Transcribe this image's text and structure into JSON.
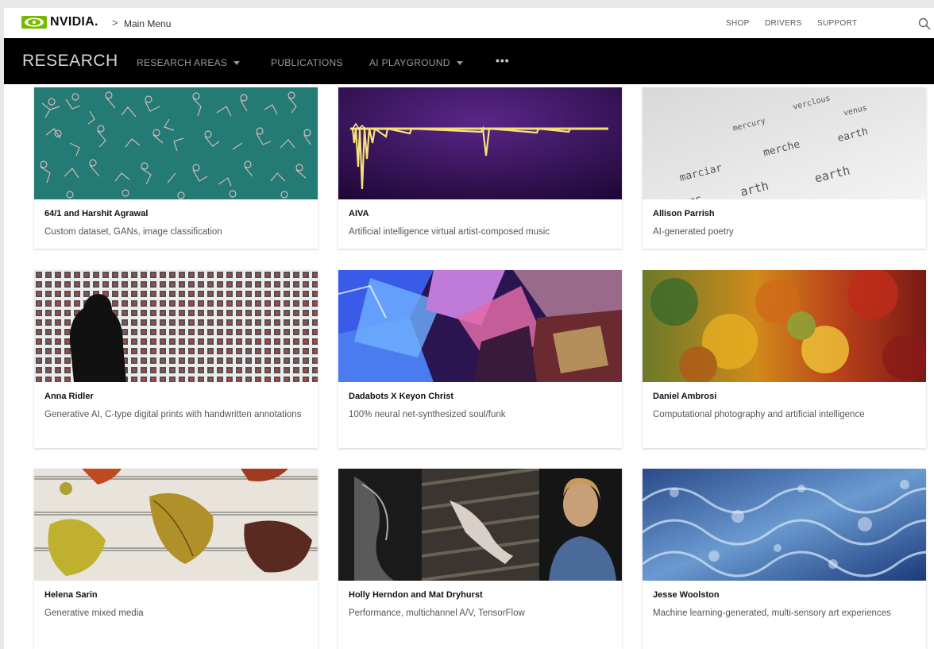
{
  "header": {
    "brand": "NVIDIA.",
    "breadcrumb_sep": ">",
    "breadcrumb": "Main Menu",
    "links": [
      "SHOP",
      "DRIVERS",
      "SUPPORT"
    ]
  },
  "nav": {
    "brand": "RESEARCH",
    "items": [
      "RESEARCH AREAS",
      "PUBLICATIONS",
      "AI PLAYGROUND"
    ],
    "more": "•••"
  },
  "colors": {
    "accent": "#76b900",
    "navbar": "#000000"
  },
  "cards": [
    {
      "title": "64/1 and Harshit Agrawal",
      "desc": "Custom dataset, GANs, image classification"
    },
    {
      "title": "AIVA",
      "desc": "Artificial intelligence virtual artist-composed music"
    },
    {
      "title": "Allison Parrish",
      "desc": "AI-generated poetry",
      "poem_words": [
        "mercury",
        "verclous",
        "venus",
        "marciar",
        "merche",
        "earth",
        "mars",
        "arth",
        "earth"
      ]
    },
    {
      "title": "Anna Ridler",
      "desc": "Generative AI, C-type digital prints with handwritten annotations"
    },
    {
      "title": "Dadabots X Keyon Christ",
      "desc": "100% neural net-synthesized soul/funk"
    },
    {
      "title": "Daniel Ambrosi",
      "desc": "Computational photography and artificial intelligence"
    },
    {
      "title": "Helena Sarin",
      "desc": "Generative mixed media"
    },
    {
      "title": "Holly Herndon and Mat Dryhurst",
      "desc": "Performance, multichannel A/V, TensorFlow"
    },
    {
      "title": "Jesse Woolston",
      "desc": "Machine learning-generated, multi-sensory art experiences"
    }
  ]
}
